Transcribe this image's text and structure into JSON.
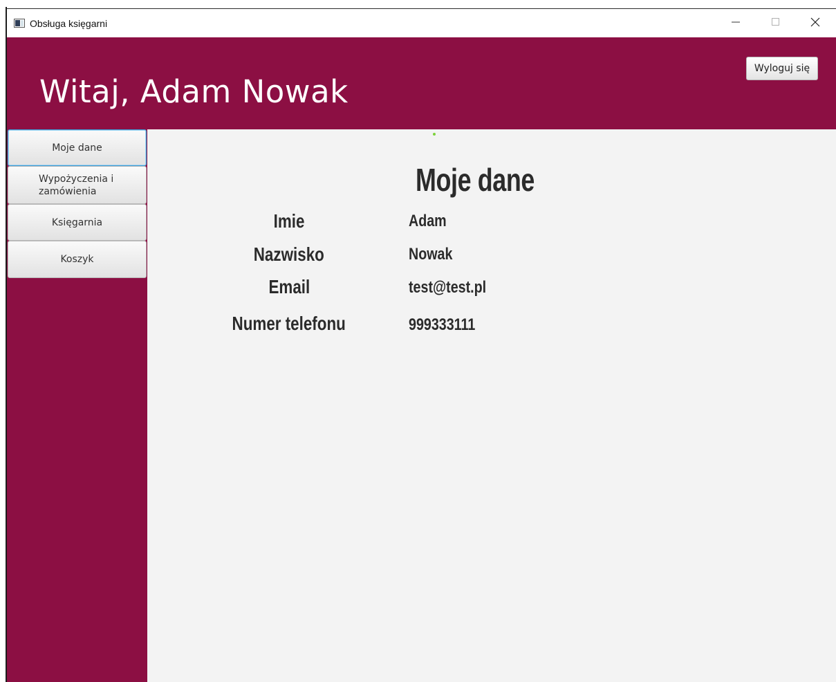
{
  "window": {
    "title": "Obsługa księgarni",
    "icons": {
      "app": "app-window-icon",
      "minimize": "minimize-icon",
      "maximize": "maximize-icon",
      "close": "close-icon"
    }
  },
  "header": {
    "welcome": "Witaj, Adam Nowak",
    "logout_label": "Wyloguj się"
  },
  "sidebar": {
    "items": [
      {
        "label": "Moje dane",
        "active": true
      },
      {
        "label_line1": "Wypożyczenia i",
        "label_line2": "zamówienia"
      },
      {
        "label": "Księgarnia"
      },
      {
        "label": "Koszyk"
      }
    ]
  },
  "content": {
    "title": "Moje dane",
    "fields": [
      {
        "label": "Imie",
        "value": "Adam"
      },
      {
        "label": "Nazwisko",
        "value": "Nowak"
      },
      {
        "label": "Email",
        "value": "test@test.pl"
      },
      {
        "label": "Numer telefonu",
        "value": "999333111"
      }
    ]
  },
  "colors": {
    "brand": "#8c0f43",
    "content_bg": "#f3f3f3",
    "active_border": "#3b9ed6"
  }
}
